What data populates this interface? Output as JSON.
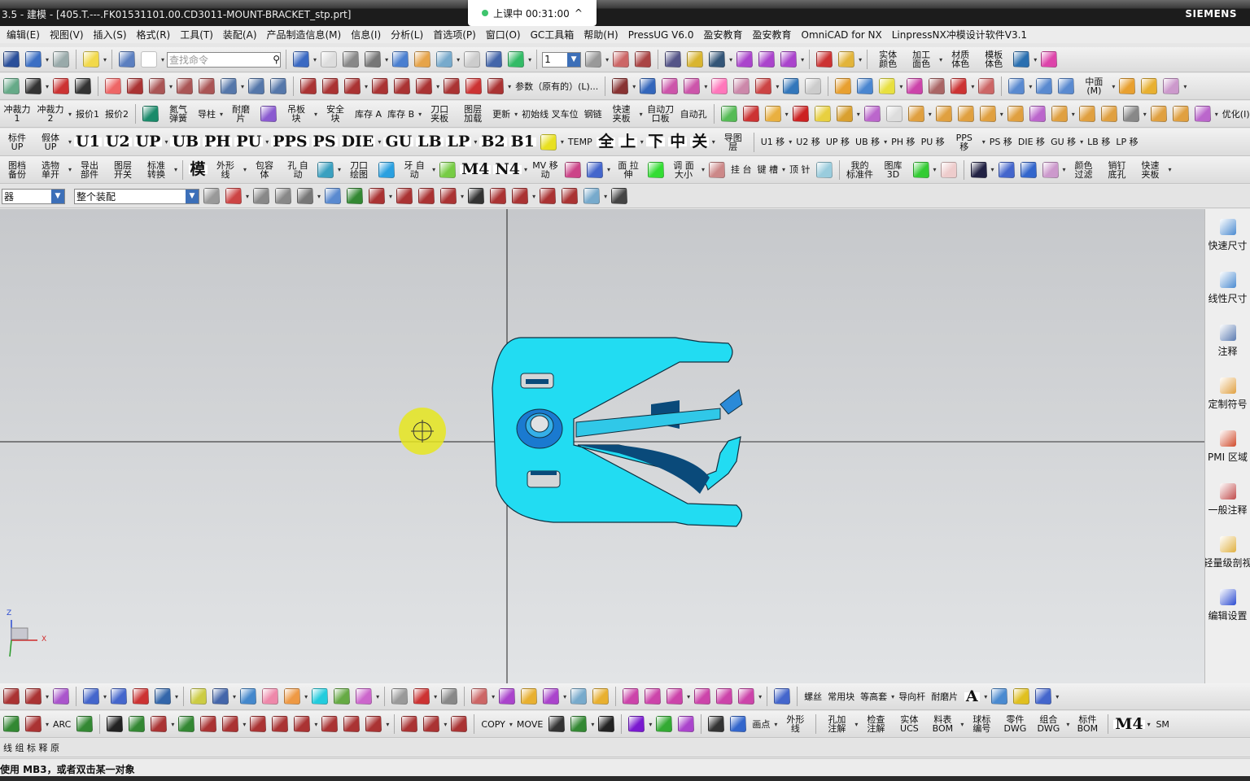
{
  "window": {
    "title": "3.5 - 建模 - [405.T.---.FK01531101.00.CD3011-MOUNT-BRACKET_stp.prt]",
    "brand": "SIEMENS"
  },
  "popup": {
    "text": "上课中 00:31:00",
    "chevron": "^"
  },
  "menu": [
    "编辑(E)",
    "视图(V)",
    "插入(S)",
    "格式(R)",
    "工具(T)",
    "装配(A)",
    "产品制造信息(M)",
    "信息(I)",
    "分析(L)",
    "首选项(P)",
    "窗口(O)",
    "GC工具箱",
    "帮助(H)",
    "PressUG V6.0",
    "盈安教育",
    "盈安教育",
    "OmniCAD for NX",
    "LinpressNX冲模设计软件V3.1"
  ],
  "search": {
    "placeholder": "查找命令"
  },
  "layer_value": "1",
  "filter": {
    "type": "器",
    "scope": "整个装配"
  },
  "toolbars": [
    [
      {
        "i": "save-icon",
        "c": "#2a4f9a"
      },
      {
        "i": "undo-icon",
        "c": "#3b6fc4"
      },
      {
        "i": "redo-icon",
        "c": "#9aa"
      },
      "|",
      {
        "i": "display-icon",
        "c": "#f2d94a"
      },
      "|",
      {
        "i": "edit-object-icon",
        "c": "#5b7fc0"
      },
      {
        "i": "window-icon",
        "c": "#fff"
      },
      "SEARCH",
      "|",
      {
        "i": "fit-icon",
        "c": "#3a69c2"
      },
      {
        "i": "grid-icon",
        "c": "#ddd"
      },
      {
        "i": "layer-icon",
        "c": "#888"
      },
      {
        "i": "printer-icon",
        "c": "#777"
      },
      {
        "i": "cube-icon",
        "c": "#4a7fd0"
      },
      {
        "i": "folder-icon",
        "c": "#e6a44a"
      },
      {
        "i": "plane-icon",
        "c": "#7ac"
      },
      {
        "i": "blank-icon",
        "c": "#ccc"
      },
      {
        "i": "move-icon",
        "c": "#46a"
      },
      {
        "i": "assembly-icon",
        "c": "#3b6"
      },
      "|",
      "LAYER",
      {
        "i": "layers-icon",
        "c": "#999"
      },
      {
        "i": "csys-icon",
        "c": "#c66"
      },
      {
        "i": "wcs-icon",
        "c": "#a44"
      },
      "|",
      {
        "i": "component-icon",
        "c": "#558"
      },
      {
        "i": "key-icon",
        "c": "#d9b530"
      },
      {
        "i": "mirror-icon",
        "c": "#357"
      },
      {
        "i": "array-icon",
        "c": "#a4c"
      },
      {
        "i": "link-icon",
        "c": "#a4c"
      },
      {
        "i": "replace-icon",
        "c": "#a4c"
      },
      "|",
      {
        "i": "measure-icon",
        "c": "#c33"
      },
      {
        "i": "ruler-icon",
        "c": "#e2b43a"
      },
      "|",
      {
        "t": "实体 颜色"
      },
      {
        "t": "加工 面色"
      },
      {
        "t": "材质 体色"
      },
      {
        "t": "模板 体色"
      },
      {
        "i": "globe-icon",
        "c": "#2a6fb0"
      },
      {
        "i": "gear-icon",
        "c": "#d4a"
      }
    ],
    [
      {
        "i": "datum-csys-icon",
        "c": "#6a8"
      },
      {
        "i": "point-icon",
        "c": "#333"
      },
      {
        "i": "circle-point-icon",
        "c": "#c33"
      },
      {
        "i": "spline-icon",
        "c": "#333"
      },
      "|",
      {
        "i": "sketch-icon",
        "c": "#e66"
      },
      {
        "i": "offset-curve-icon",
        "c": "#a33"
      },
      {
        "i": "bridge-icon",
        "c": "#a55"
      },
      {
        "i": "bridge2-icon",
        "c": "#a55"
      },
      {
        "i": "project-icon",
        "c": "#a55"
      },
      {
        "i": "intersect-icon",
        "c": "#57a"
      },
      {
        "i": "section-icon",
        "c": "#57a"
      },
      {
        "i": "wrap-icon",
        "c": "#57a"
      },
      "|",
      {
        "i": "trim-icon",
        "c": "#a33"
      },
      {
        "i": "split-icon",
        "c": "#a33"
      },
      {
        "i": "fillet-curve-icon",
        "c": "#a33"
      },
      {
        "i": "chamfer-curve-icon",
        "c": "#a33"
      },
      {
        "i": "join-icon",
        "c": "#a33"
      },
      {
        "i": "extend-icon",
        "c": "#a33"
      },
      {
        "i": "edit-curve-icon",
        "c": "#a33"
      },
      {
        "i": "magic-icon",
        "c": "#c33"
      },
      {
        "i": "smooth-icon",
        "c": "#a33"
      },
      {
        "t": "参数（原有的）(L)..."
      },
      "|",
      {
        "i": "angle-icon",
        "c": "#833"
      },
      {
        "i": "mesh-icon",
        "c": "#36b"
      },
      {
        "i": "surface-icon",
        "c": "#c5a"
      },
      {
        "i": "surface2-icon",
        "c": "#c5a"
      },
      {
        "i": "plane-face-icon",
        "c": "#f7b"
      },
      {
        "i": "grid-surface-icon",
        "c": "#c8a"
      },
      {
        "i": "patch-icon",
        "c": "#c44"
      },
      {
        "i": "sew-icon",
        "c": "#37b"
      },
      {
        "i": "box-icon",
        "c": "#ccc"
      },
      "|",
      {
        "i": "block-icon",
        "c": "#e8a030"
      },
      {
        "i": "cylinder-icon",
        "c": "#4a86d0"
      },
      {
        "i": "sphere-icon",
        "c": "#e8e040"
      },
      {
        "i": "tube-icon",
        "c": "#c4a"
      },
      {
        "i": "cone-icon",
        "c": "#a66"
      },
      {
        "i": "hole-icon",
        "c": "#c33"
      },
      {
        "i": "rib-icon",
        "c": "#c66"
      },
      "|",
      {
        "i": "shell-icon",
        "c": "#5a8ad0"
      },
      {
        "i": "solid-icon",
        "c": "#5a8ad0"
      },
      {
        "i": "face-icon",
        "c": "#5a8ad0"
      },
      {
        "t": "中面(M)"
      },
      {
        "i": "thicken-icon",
        "c": "#e8a030"
      },
      {
        "i": "flange-icon",
        "c": "#e8b030"
      },
      {
        "i": "bend-icon",
        "c": "#c9c"
      }
    ],
    [
      {
        "t": "冲裁力1"
      },
      {
        "t": "冲裁力2"
      },
      {
        "t": "报价1"
      },
      {
        "t": "报价2"
      },
      "|",
      {
        "i": "calculator-icon",
        "c": "#1a8a6a"
      },
      {
        "t": "氮气 弹簧"
      },
      {
        "t": "导柱"
      },
      {
        "t": "耐磨 片"
      },
      {
        "i": "plate-icon",
        "c": "#8a5ad0"
      },
      {
        "t": "吊板 块"
      },
      {
        "t": "安全 块"
      },
      {
        "t": "库存 A"
      },
      {
        "t": "库存 B"
      },
      {
        "t": "刀口 夹板"
      },
      {
        "t": "图层 加载"
      },
      {
        "t": "更新"
      },
      {
        "t": "初始线 叉车位"
      },
      {
        "t": "钢链"
      },
      {
        "t": "快速 夹板"
      },
      {
        "t": "自动刀口板"
      },
      {
        "t": "自动孔"
      },
      "|",
      {
        "i": "part-icon",
        "c": "#5b5"
      },
      {
        "i": "wave-icon",
        "c": "#c33"
      },
      {
        "i": "stack-icon",
        "c": "#e9b040"
      },
      {
        "i": "red-box-icon",
        "c": "#c22"
      },
      {
        "i": "yellow-box-icon",
        "c": "#e8d040"
      },
      {
        "i": "bin-icon",
        "c": "#d9a030"
      },
      {
        "i": "move-body-icon",
        "c": "#b6c"
      },
      {
        "i": "door-icon",
        "c": "#ddd"
      },
      {
        "i": "body1-icon",
        "c": "#e0a040"
      },
      {
        "i": "body2-icon",
        "c": "#e0a040"
      },
      {
        "i": "body3-icon",
        "c": "#e0a040"
      },
      {
        "i": "body4-icon",
        "c": "#e0a040"
      },
      {
        "i": "body5-icon",
        "c": "#e0a040"
      },
      {
        "i": "body6-icon",
        "c": "#b6c"
      },
      {
        "i": "body7-icon",
        "c": "#e0a040"
      },
      {
        "i": "body8-icon",
        "c": "#e0a040"
      },
      {
        "i": "body9-icon",
        "c": "#e0a040"
      },
      {
        "i": "hex-icon",
        "c": "#888"
      },
      {
        "i": "body10-icon",
        "c": "#e0a040"
      },
      {
        "i": "body11-icon",
        "c": "#e0a040"
      },
      {
        "i": "body12-icon",
        "c": "#b6c"
      },
      {
        "t": "优化(I)"
      }
    ],
    [
      {
        "t": "标件 UP"
      },
      {
        "t": "假体 UP"
      },
      {
        "b": "U1"
      },
      {
        "b": "U2"
      },
      {
        "b": "UP"
      },
      {
        "b": "UB"
      },
      {
        "b": "PH"
      },
      {
        "b": "PU"
      },
      {
        "b": "PPS"
      },
      {
        "b": "PS"
      },
      {
        "b": "DIE"
      },
      {
        "b": "GU"
      },
      {
        "b": "LB"
      },
      {
        "b": "LP"
      },
      {
        "b": "B2"
      },
      {
        "b": "B1"
      },
      {
        "i": "ring-icon",
        "c": "#e8e020"
      },
      {
        "t": "TEMP"
      },
      {
        "b": "全"
      },
      {
        "b": "上"
      },
      {
        "b": "下"
      },
      {
        "b": "中"
      },
      {
        "b": "关"
      },
      {
        "t": "导图 层"
      },
      "|",
      {
        "t": "U1 移"
      },
      {
        "t": "U2 移"
      },
      {
        "t": "UP 移"
      },
      {
        "t": "UB 移"
      },
      {
        "t": "PH 移"
      },
      {
        "t": "PU 移"
      },
      {
        "t": "PPS 移"
      },
      {
        "t": "PS 移"
      },
      {
        "t": "DIE 移"
      },
      {
        "t": "GU 移"
      },
      {
        "t": "LB 移"
      },
      {
        "t": "LP 移"
      }
    ],
    [
      {
        "t": "图档 备份"
      },
      {
        "t": "选物 单开"
      },
      {
        "t": "导出 部件"
      },
      {
        "t": "图层 开关"
      },
      {
        "t": "标准 转换"
      },
      "|",
      {
        "b": "模"
      },
      {
        "t": "外形 线"
      },
      {
        "t": "包容 体"
      },
      {
        "t": "孔 自动"
      },
      {
        "i": "punch-icon",
        "c": "#3aa0c0"
      },
      {
        "t": "刀口 绘图"
      },
      {
        "i": "cavity-icon",
        "c": "#2aa0e0"
      },
      {
        "t": "牙 自动"
      },
      {
        "i": "pin-icon",
        "c": "#7c4"
      },
      {
        "b": "M4"
      },
      {
        "b": "N4"
      },
      {
        "t": "MV 移动"
      },
      {
        "i": "cam-icon",
        "c": "#c48"
      },
      {
        "i": "mirror2-icon",
        "c": "#46c"
      },
      {
        "t": "面 拉伸"
      },
      {
        "i": "plus-icon",
        "c": "#3d3"
      },
      {
        "t": "调 面大小"
      },
      {
        "i": "pad-icon",
        "c": "#c88"
      },
      {
        "t": "挂 台"
      },
      {
        "t": "键 槽"
      },
      {
        "t": "顶 针"
      },
      {
        "i": "sheet-icon",
        "c": "#9cd"
      },
      "|",
      {
        "t": "我的 标准件"
      },
      {
        "t": "图库 3D"
      },
      {
        "i": "spring-icon",
        "c": "#3c3"
      },
      {
        "i": "person-icon",
        "c": "#ecc"
      },
      "|",
      {
        "i": "pen-icon",
        "c": "#224"
      },
      {
        "i": "info-icon",
        "c": "#46c"
      },
      {
        "i": "gauge-icon",
        "c": "#36c"
      },
      {
        "i": "tool-icon",
        "c": "#c9c"
      },
      {
        "t": "颜色 过滤"
      },
      {
        "t": "销钉 底孔"
      },
      {
        "t": "快速 夹板"
      }
    ]
  ],
  "selection_bar": [
    {
      "i": "filter-icon",
      "c": "#999"
    },
    {
      "i": "snap-icon",
      "c": "#c44"
    },
    {
      "i": "select-icon",
      "c": "#888"
    },
    {
      "i": "rect-select-icon",
      "c": "#888"
    },
    {
      "i": "view-icon",
      "c": "#777"
    },
    {
      "i": "shaded-icon",
      "c": "#5a8ad0"
    },
    {
      "i": "snap-endpoint-icon",
      "c": "#383"
    },
    {
      "i": "snap-line-icon",
      "c": "#a33"
    },
    {
      "i": "snap-mid-icon",
      "c": "#a33"
    },
    {
      "i": "snap-curve-icon",
      "c": "#a33"
    },
    {
      "i": "snap-control-icon",
      "c": "#a33"
    },
    {
      "i": "snap-intersect-icon",
      "c": "#333"
    },
    {
      "i": "snap-center-icon",
      "c": "#a33"
    },
    {
      "i": "snap-quadrant-icon",
      "c": "#a33"
    },
    {
      "i": "snap-point-icon",
      "c": "#a33"
    },
    {
      "i": "snap-on-curve-icon",
      "c": "#a33"
    },
    {
      "i": "snap-face-icon",
      "c": "#7ac"
    },
    {
      "i": "table-icon",
      "c": "#444"
    }
  ],
  "bottom_toolbars": [
    [
      {
        "i": "line-icon",
        "c": "#a33"
      },
      {
        "i": "arc-fan-icon",
        "c": "#a33"
      },
      {
        "i": "surface3-icon",
        "c": "#a5c"
      },
      "|",
      {
        "i": "face-blend-icon",
        "c": "#46c"
      },
      {
        "i": "section2-icon",
        "c": "#46c"
      },
      {
        "i": "ruler2-icon",
        "c": "#c33"
      },
      {
        "i": "analysis-icon",
        "c": "#36a"
      },
      "|",
      {
        "i": "mesh2-icon",
        "c": "#cc4"
      },
      {
        "i": "stripe-icon",
        "c": "#46a"
      },
      {
        "i": "draft-icon",
        "c": "#48c"
      },
      {
        "i": "curvature-icon",
        "c": "#e8a"
      },
      {
        "i": "radius-icon",
        "c": "#e94"
      },
      {
        "i": "zebra-icon",
        "c": "#2cd"
      },
      {
        "i": "reflect-icon",
        "c": "#6a4"
      },
      {
        "i": "color-map-icon",
        "c": "#c6c"
      },
      "|",
      {
        "i": "weight-icon",
        "c": "#999"
      },
      {
        "i": "check-icon",
        "c": "#c33"
      },
      {
        "i": "compare-icon",
        "c": "#888"
      },
      "|",
      {
        "i": "die-icon",
        "c": "#c66"
      },
      {
        "i": "die2-icon",
        "c": "#a4c"
      },
      {
        "i": "die3-icon",
        "c": "#e8b030"
      },
      {
        "i": "die4-icon",
        "c": "#a4c"
      },
      {
        "i": "die5-icon",
        "c": "#7ac"
      },
      {
        "i": "die6-icon",
        "c": "#e8b030"
      },
      "|",
      {
        "i": "blend1-icon",
        "c": "#c4a"
      },
      {
        "i": "blend2-icon",
        "c": "#c4a"
      },
      {
        "i": "blend3-icon",
        "c": "#c4a"
      },
      {
        "i": "blend4-icon",
        "c": "#c4a"
      },
      {
        "i": "blend5-icon",
        "c": "#c4a"
      },
      {
        "i": "blend6-icon",
        "c": "#c4a"
      },
      "|",
      {
        "i": "assy-icon",
        "c": "#46c"
      },
      "|",
      {
        "t": "螺丝"
      },
      {
        "t": "常用块"
      },
      {
        "t": "等高套"
      },
      {
        "t": "导向杆"
      },
      {
        "t": "耐磨片"
      },
      {
        "b": "A"
      },
      {
        "i": "drawer-icon",
        "c": "#4a8ad0"
      },
      {
        "i": "mold-icon",
        "c": "#e0c020"
      },
      {
        "i": "stretch-icon",
        "c": "#46c"
      }
    ],
    [
      {
        "i": "polygon-icon",
        "c": "#383"
      },
      {
        "i": "circle-tangent-icon",
        "c": "#a33"
      },
      {
        "t": "ARC"
      },
      {
        "i": "arch-icon",
        "c": "#383"
      },
      "|",
      {
        "i": "line2-icon",
        "c": "#222"
      },
      {
        "i": "line3-icon",
        "c": "#383"
      },
      {
        "i": "line-circle-icon",
        "c": "#a33"
      },
      {
        "i": "line4-icon",
        "c": "#383"
      },
      {
        "i": "line5-icon",
        "c": "#a33"
      },
      {
        "i": "angle2-icon",
        "c": "#a33"
      },
      {
        "i": "circle-icon",
        "c": "#a33"
      },
      {
        "i": "circle2-icon",
        "c": "#a33"
      },
      {
        "i": "circle3-icon",
        "c": "#a33"
      },
      {
        "i": "circle4-icon",
        "c": "#a33"
      },
      {
        "i": "circle5-icon",
        "c": "#a33"
      },
      {
        "i": "circle6-icon",
        "c": "#a33"
      },
      "|",
      {
        "i": "fillet-icon",
        "c": "#a33"
      },
      {
        "i": "circle7-icon",
        "c": "#a33"
      },
      {
        "i": "trim2-icon",
        "c": "#a33"
      },
      "|",
      {
        "t": "COPY"
      },
      {
        "t": "MOVE"
      },
      {
        "i": "mirror3-icon",
        "c": "#333"
      },
      {
        "i": "pattern-icon",
        "c": "#383"
      },
      {
        "i": "axis-icon",
        "c": "#222"
      },
      "|",
      {
        "i": "purple-box-icon",
        "c": "#7a1ad0"
      },
      {
        "i": "curve-icon",
        "c": "#3a3"
      },
      {
        "i": "curves-icon",
        "c": "#a4c"
      },
      "|",
      {
        "i": "wave2-icon",
        "c": "#333"
      },
      {
        "i": "dim-icon",
        "c": "#36c"
      },
      {
        "t": "画点"
      },
      {
        "t": "外形 线"
      },
      "|",
      {
        "t": "孔加 注解"
      },
      {
        "t": "检查 注解"
      },
      {
        "t": "实体 UCS"
      },
      {
        "t": "料表 BOM"
      },
      {
        "t": "球标 编号"
      },
      {
        "t": "零件 DWG"
      },
      {
        "t": "组合 DWG"
      },
      {
        "t": "标件 BOM"
      },
      "|",
      {
        "b": "M4"
      },
      {
        "t": "SM"
      }
    ],
    [
      {
        "t": "线 组 标 释 原"
      }
    ]
  ],
  "right_panel": [
    "快速尺寸",
    "线性尺寸",
    "注释",
    "定制符号",
    "PMI 区域",
    "一般注释",
    "轻量级剖视",
    "编辑设置"
  ],
  "triad": {
    "z": "Z",
    "x": "X"
  },
  "status": "使用 MB3，或者双击某一对象"
}
